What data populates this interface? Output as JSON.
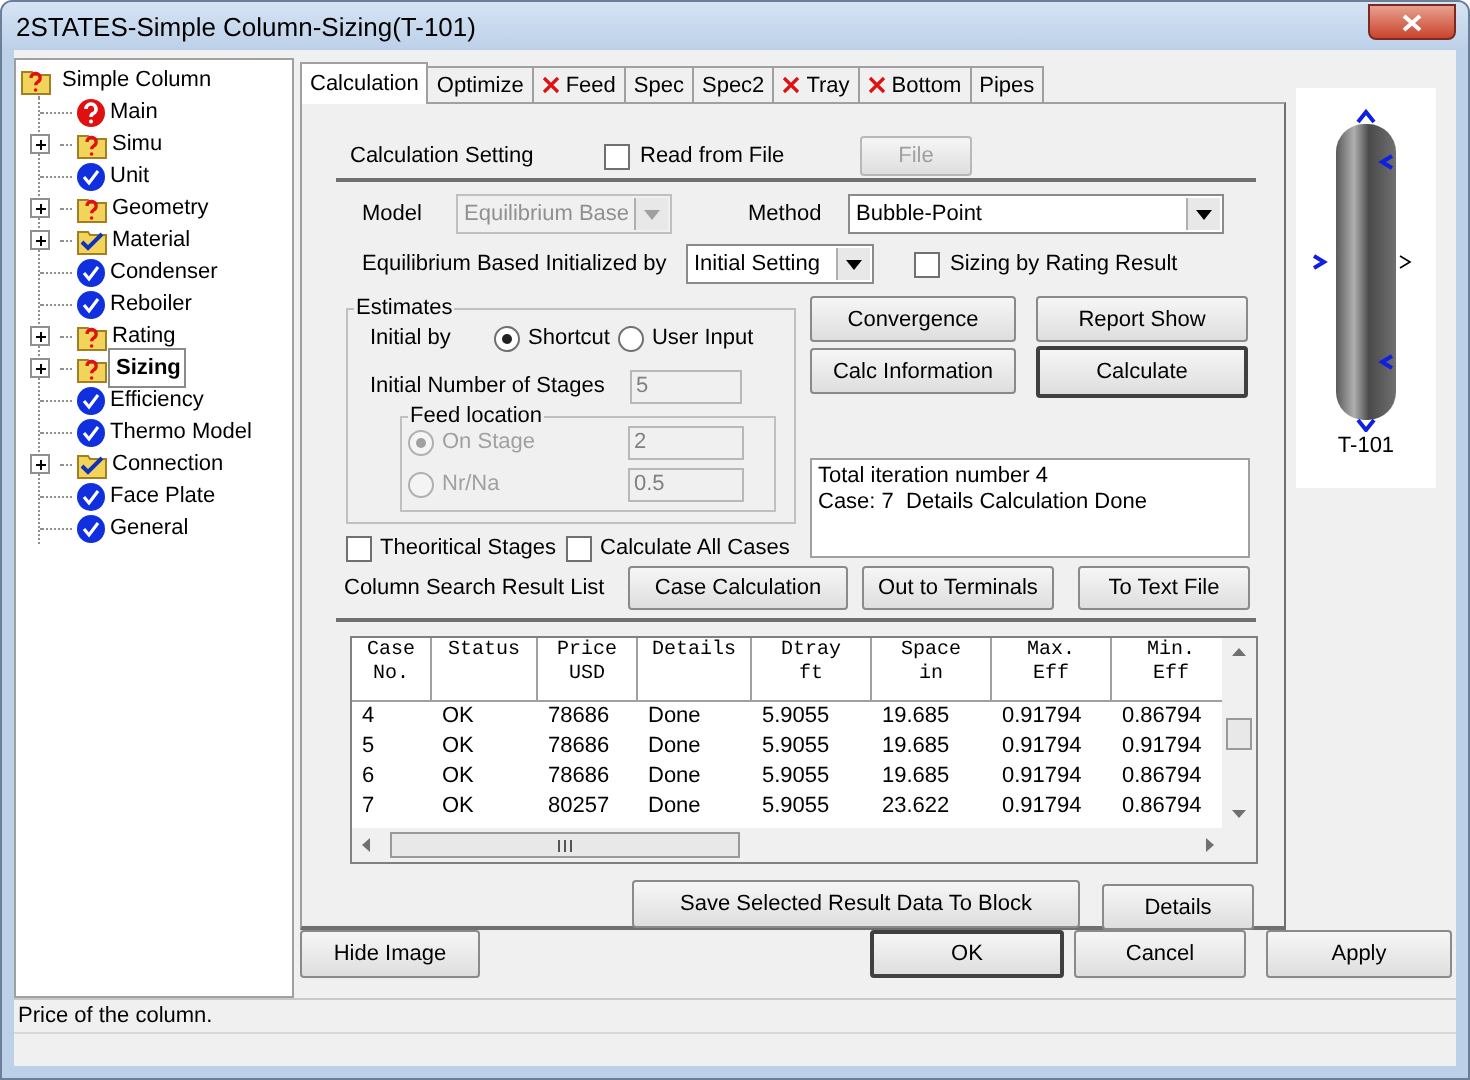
{
  "window": {
    "title": "2STATES-Simple Column-Sizing(T-101)"
  },
  "tree": {
    "label": "Simple Column",
    "kind": "folder_warning",
    "children": [
      {
        "label": "Main",
        "kind": "error",
        "selected": false
      },
      {
        "label": "Simu",
        "kind": "folder_warning",
        "expanded": false,
        "selected": false
      },
      {
        "label": "Unit",
        "kind": "check",
        "selected": false
      },
      {
        "label": "Geometry",
        "kind": "folder_warning",
        "expanded": false,
        "selected": false
      },
      {
        "label": "Material",
        "kind": "folder_check",
        "expanded": false,
        "selected": false
      },
      {
        "label": "Condenser",
        "kind": "check",
        "selected": false
      },
      {
        "label": "Reboiler",
        "kind": "check",
        "selected": false
      },
      {
        "label": "Rating",
        "kind": "folder_warning",
        "expanded": false,
        "selected": false
      },
      {
        "label": "Sizing",
        "kind": "folder_warning",
        "expanded": false,
        "selected": true
      },
      {
        "label": "Efficiency",
        "kind": "check",
        "selected": false
      },
      {
        "label": "Thermo Model",
        "kind": "check",
        "selected": false
      },
      {
        "label": "Connection",
        "kind": "folder_check",
        "expanded": false,
        "selected": false
      },
      {
        "label": "Face Plate",
        "kind": "check",
        "selected": false
      },
      {
        "label": "General",
        "kind": "check",
        "selected": false
      }
    ]
  },
  "tabs": [
    {
      "label": "Calculation",
      "selected": true,
      "error": false
    },
    {
      "label": "Optimize",
      "selected": false,
      "error": false
    },
    {
      "label": "Feed",
      "selected": false,
      "error": true
    },
    {
      "label": "Spec",
      "selected": false,
      "error": false
    },
    {
      "label": "Spec2",
      "selected": false,
      "error": false
    },
    {
      "label": "Tray",
      "selected": false,
      "error": true
    },
    {
      "label": "Bottom",
      "selected": false,
      "error": true
    },
    {
      "label": "Pipes",
      "selected": false,
      "error": false
    }
  ],
  "calculation": {
    "section_title": "Calculation Setting",
    "read_from_file": {
      "label": "Read from File",
      "checked": false
    },
    "file_button": {
      "label": "File",
      "disabled": true
    },
    "model": {
      "label": "Model",
      "value": "Equilibrium Base",
      "disabled": true
    },
    "method": {
      "label": "Method",
      "value": "Bubble-Point",
      "disabled": false
    },
    "initialized_by": {
      "label": "Equilibrium Based Initialized by",
      "value": "Initial Setting",
      "disabled": false
    },
    "sizing_by_rating": {
      "label": "Sizing by Rating Result",
      "checked": false
    },
    "estimates": {
      "title": "Estimates",
      "initial_by_label": "Initial by",
      "options": [
        {
          "label": "Shortcut",
          "selected": true
        },
        {
          "label": "User Input",
          "selected": false
        }
      ],
      "stages_label": "Initial Number of Stages",
      "stages_value": "5",
      "feed_location": {
        "title": "Feed location",
        "disabled": true,
        "options": [
          {
            "label": "On Stage",
            "selected": true,
            "value": "2"
          },
          {
            "label": "Nr/Na",
            "selected": false,
            "value": "0.5"
          }
        ]
      }
    },
    "action_buttons": [
      {
        "label": "Convergence",
        "default": false
      },
      {
        "label": "Report Show",
        "default": false
      },
      {
        "label": "Calc Information",
        "default": false
      },
      {
        "label": "Calculate",
        "default": true
      }
    ],
    "log": [
      "Total iteration number 4",
      "Case: 7  Details Calculation Done"
    ],
    "options": [
      {
        "label": "Theoritical Stages",
        "checked": false
      },
      {
        "label": "Calculate All Cases",
        "checked": false
      }
    ],
    "result_list": {
      "label": "Column Search Result List",
      "buttons": [
        "Case Calculation",
        "Out to Terminals",
        "To Text File"
      ]
    },
    "table": {
      "columns": [
        "Case\nNo.",
        "Status",
        "Price\nUSD",
        "Details",
        "Dtray\nft",
        "Space\nin",
        "Max.\nEff",
        "Min.\nEff"
      ],
      "rows": [
        [
          "4",
          "OK",
          "78686",
          "Done",
          "5.9055",
          "19.685",
          "0.91794",
          "0.86794"
        ],
        [
          "5",
          "OK",
          "78686",
          "Done",
          "5.9055",
          "19.685",
          "0.91794",
          "0.91794"
        ],
        [
          "6",
          "OK",
          "78686",
          "Done",
          "5.9055",
          "19.685",
          "0.91794",
          "0.86794"
        ],
        [
          "7",
          "OK",
          "80257",
          "Done",
          "5.9055",
          "23.622",
          "0.91794",
          "0.86794"
        ]
      ]
    },
    "save_button": "Save Selected Result Data To Block",
    "details_button": "Details"
  },
  "diagram": {
    "label": "T-101"
  },
  "buttons": [
    {
      "label": "Hide Image",
      "default": false
    },
    {
      "label": "OK",
      "default": true
    },
    {
      "label": "Cancel",
      "default": false
    },
    {
      "label": "Apply",
      "default": false
    }
  ],
  "status_bar": "Price of the column."
}
